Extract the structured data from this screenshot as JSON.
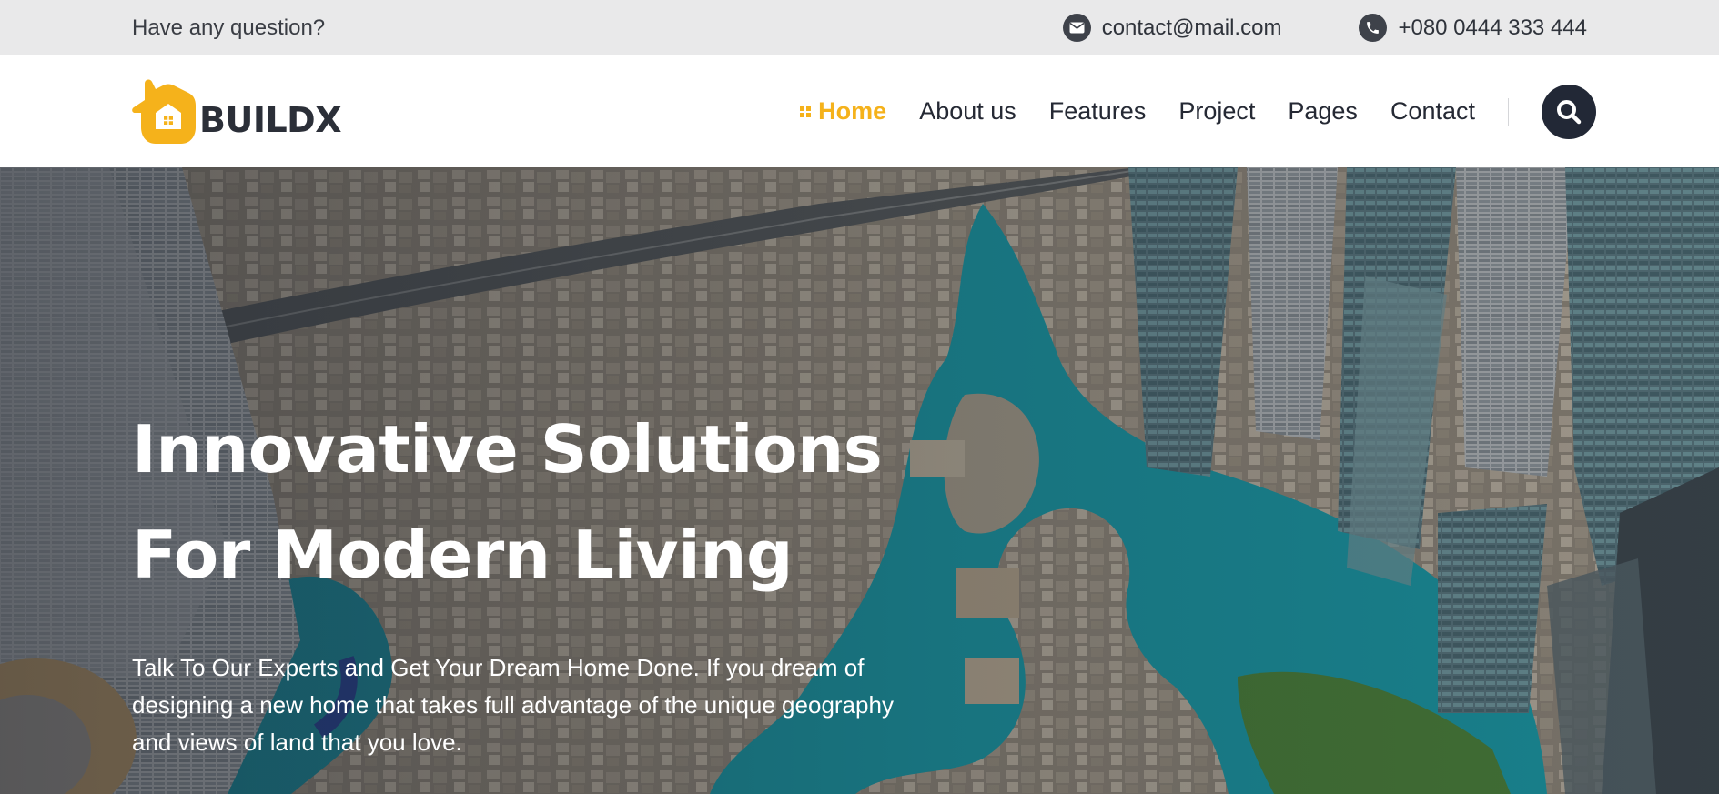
{
  "topbar": {
    "question": "Have any question?",
    "email": "contact@mail.com",
    "phone": "+080 0444 333 444"
  },
  "brand": {
    "name": "BUILDX",
    "accent_color": "#f5b21b",
    "dark_color": "#222836"
  },
  "nav": {
    "items": [
      {
        "label": "Home",
        "active": true
      },
      {
        "label": "About us",
        "active": false
      },
      {
        "label": "Features",
        "active": false
      },
      {
        "label": "Project",
        "active": false
      },
      {
        "label": "Pages",
        "active": false
      },
      {
        "label": "Contact",
        "active": false
      }
    ],
    "search_icon": "search-icon"
  },
  "hero": {
    "title_line1": "Innovative Solutions",
    "title_line2": "For Modern Living",
    "text": "Talk To Our Experts and Get Your Dream Home Done. If you dream of designing a new home that takes full advantage of the unique geography and views of land that you love."
  }
}
